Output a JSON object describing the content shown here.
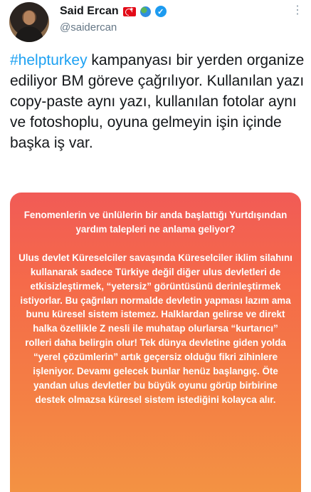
{
  "tweet": {
    "author_name": "Said Ercan",
    "handle": "@saidercan",
    "hashtag": "#helpturkey",
    "body_after_hashtag": " kampanyası bir yerden organize ediliyor BM göreve çağrılıyor. Kullanılan yazı copy-paste aynı yazı, kullanılan fotolar aynı ve fotoshoplu, oyuna gelmeyin işin içinde başka iş var.",
    "badges": [
      "turkey-flag-icon",
      "globe-icon",
      "verified-icon"
    ]
  },
  "image": {
    "heading": "Fenomenlerin ve ünlülerin bir anda başlattığı Yurtdışından yardım talepleri ne anlama geliyor?",
    "body": "Ulus devlet Küreselciler savaşında Küreselciler iklim silahını kullanarak sadece Türkiye değil diğer ulus devletleri de etkisizleştirmek, “yetersiz” görüntüsünü derinleştirmek istiyorlar. Bu çağrıları normalde devletin yapması lazım ama bunu küresel sistem istemez. Halklardan gelirse ve direkt halka özellikle Z nesli ile muhatap olurlarsa “kurtarıcı” rolleri daha belirgin olur! Tek dünya devletine giden yolda “yerel çözümlerin” artık geçersiz olduğu fikri zihinlere işleniyor. Devamı gelecek bunlar henüz başlangıç. Öte yandan ulus devletler bu büyük oyunu görüp birbirine destek olmazsa küresel sistem istediğini kolayca alır.",
    "gradient_top": "#f15b56",
    "gradient_bottom": "#f39243"
  },
  "colors": {
    "hashtag": "#1da1f2",
    "verified": "#1d9bf0",
    "handle": "#657786"
  }
}
